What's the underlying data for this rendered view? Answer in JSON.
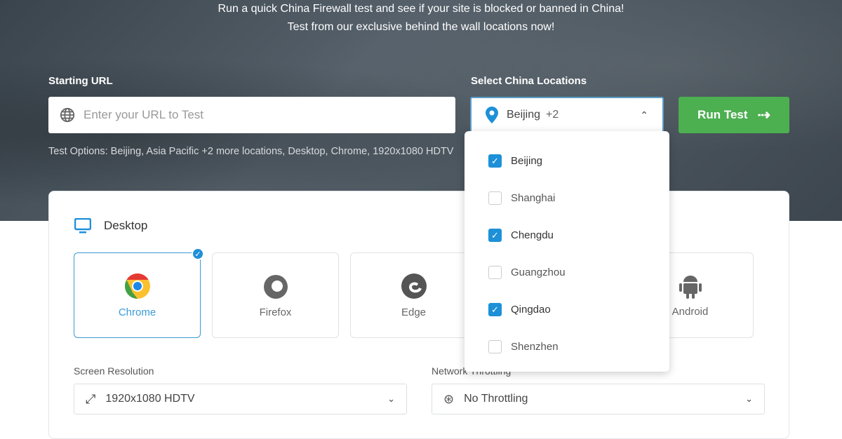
{
  "hero": {
    "line1": "Run a quick China Firewall test and see if your site is blocked or banned in China!",
    "line2": "Test from our exclusive behind the wall locations now!"
  },
  "url": {
    "label": "Starting URL",
    "placeholder": "Enter your URL to Test",
    "value": ""
  },
  "locations": {
    "label": "Select China Locations",
    "selected": "Beijing",
    "extra": "+2",
    "options": [
      {
        "label": "Beijing",
        "checked": true
      },
      {
        "label": "Shanghai",
        "checked": false
      },
      {
        "label": "Chengdu",
        "checked": true
      },
      {
        "label": "Guangzhou",
        "checked": false
      },
      {
        "label": "Qingdao",
        "checked": true
      },
      {
        "label": "Shenzhen",
        "checked": false
      }
    ]
  },
  "run_label": "Run Test",
  "test_options": "Test Options: Beijing, Asia Pacific +2 more locations, Desktop, Chrome, 1920x1080 HDTV",
  "device": {
    "title": "Desktop",
    "browsers": [
      {
        "label": "Chrome",
        "selected": true
      },
      {
        "label": "Firefox"
      },
      {
        "label": "Edge"
      },
      {
        "label": ""
      },
      {
        "label": "Android"
      }
    ]
  },
  "resolution": {
    "label": "Screen Resolution",
    "value": "1920x1080 HDTV"
  },
  "throttling": {
    "label": "Network Throttling",
    "value": "No Throttling"
  },
  "colors": {
    "accent": "#1e90d8",
    "run": "#4caf50"
  }
}
